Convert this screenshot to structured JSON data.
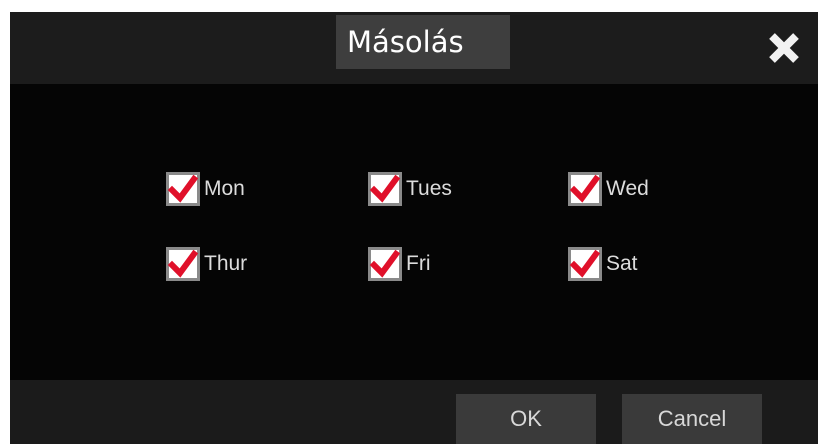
{
  "dialog": {
    "title": "Másolás",
    "close_icon": "close-icon"
  },
  "days": [
    {
      "label": "Mon",
      "checked": true
    },
    {
      "label": "Tues",
      "checked": true
    },
    {
      "label": "Wed",
      "checked": true
    },
    {
      "label": "Thur",
      "checked": true
    },
    {
      "label": "Fri",
      "checked": true
    },
    {
      "label": "Sat",
      "checked": true
    }
  ],
  "buttons": {
    "ok_label": "OK",
    "cancel_label": "Cancel"
  },
  "colors": {
    "dialog_background": "#050505",
    "titlebar_background": "#1c1c1c",
    "title_box_background": "#3e3e3e",
    "checkmark": "#e0102a",
    "button_background": "#3a3a3a",
    "text": "#dcdcdc"
  }
}
